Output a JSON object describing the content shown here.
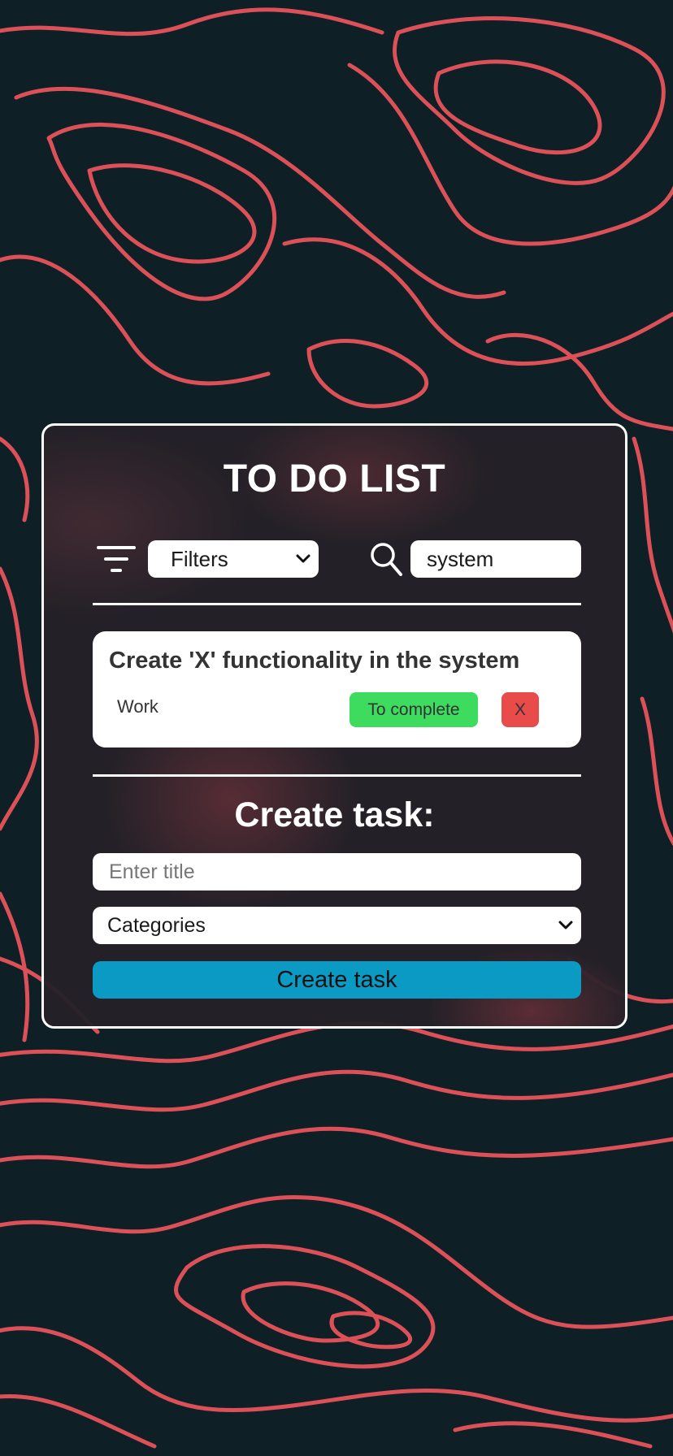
{
  "app": {
    "title": "TO DO LIST"
  },
  "toolbar": {
    "filter_icon": "filter-lines-icon",
    "filters_value": "Filters",
    "search_icon": "magnifier-icon",
    "search_value": "system"
  },
  "tasks": [
    {
      "title": "Create 'X' functionality in the system",
      "category": "Work",
      "complete_label": "To complete",
      "delete_label": "X"
    }
  ],
  "create": {
    "heading": "Create task:",
    "title_placeholder": "Enter title",
    "categories_value": "Categories",
    "button_label": "Create task"
  },
  "colors": {
    "background": "#0f1f26",
    "contour_lines": "#e8545a",
    "complete_button": "#3ddc5e",
    "delete_button": "#e94a4a",
    "create_button": "#0b9ac4"
  }
}
